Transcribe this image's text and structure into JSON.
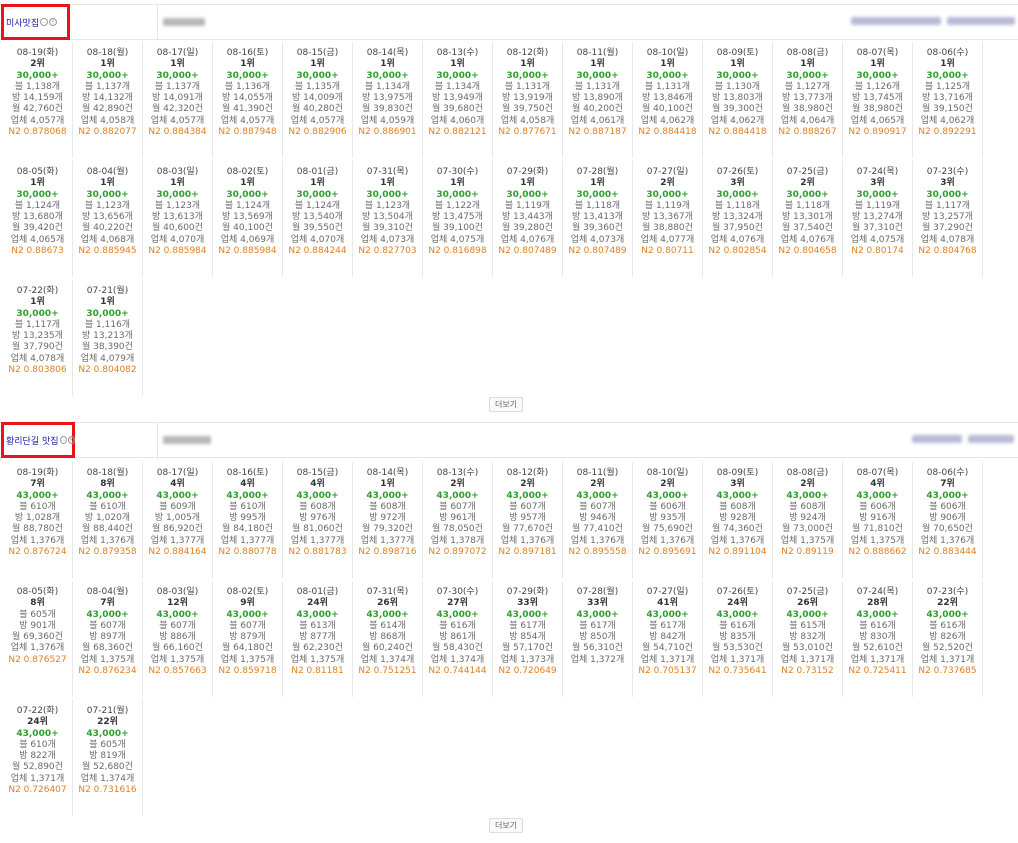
{
  "common": {
    "more_label": "더보기",
    "icon_glyph": "ⓟ"
  },
  "sections": [
    {
      "keyword": "미사맛집",
      "days": [
        {
          "date": "08-19(화)",
          "rank": "2위",
          "search": "30,000+",
          "posts": "블 1,138개",
          "shops": "방 14,159개",
          "monthly": "월 42,760건",
          "biz": "업체 4,057개",
          "n2": "N2 0.878068"
        },
        {
          "date": "08-18(월)",
          "rank": "1위",
          "search": "30,000+",
          "posts": "블 1,137개",
          "shops": "방 14,132개",
          "monthly": "월 42,890건",
          "biz": "업체 4,058개",
          "n2": "N2 0.882077"
        },
        {
          "date": "08-17(일)",
          "rank": "1위",
          "search": "30,000+",
          "posts": "블 1,137개",
          "shops": "방 14,091개",
          "monthly": "월 42,320건",
          "biz": "업체 4,057개",
          "n2": "N2 0.884384"
        },
        {
          "date": "08-16(토)",
          "rank": "1위",
          "search": "30,000+",
          "posts": "블 1,136개",
          "shops": "방 14,055개",
          "monthly": "월 41,390건",
          "biz": "업체 4,057개",
          "n2": "N2 0.887948"
        },
        {
          "date": "08-15(금)",
          "rank": "1위",
          "search": "30,000+",
          "posts": "블 1,135개",
          "shops": "방 14,009개",
          "monthly": "월 40,280건",
          "biz": "업체 4,057개",
          "n2": "N2 0.882906"
        },
        {
          "date": "08-14(목)",
          "rank": "1위",
          "search": "30,000+",
          "posts": "블 1,134개",
          "shops": "방 13,975개",
          "monthly": "월 39,830건",
          "biz": "업체 4,059개",
          "n2": "N2 0.886901"
        },
        {
          "date": "08-13(수)",
          "rank": "1위",
          "search": "30,000+",
          "posts": "블 1,134개",
          "shops": "방 13,949개",
          "monthly": "월 39,680건",
          "biz": "업체 4,060개",
          "n2": "N2 0.882121"
        },
        {
          "date": "08-12(화)",
          "rank": "1위",
          "search": "30,000+",
          "posts": "블 1,131개",
          "shops": "방 13,919개",
          "monthly": "월 39,750건",
          "biz": "업체 4,058개",
          "n2": "N2 0.877671"
        },
        {
          "date": "08-11(월)",
          "rank": "1위",
          "search": "30,000+",
          "posts": "블 1,131개",
          "shops": "방 13,890개",
          "monthly": "월 40,200건",
          "biz": "업체 4,061개",
          "n2": "N2 0.887187"
        },
        {
          "date": "08-10(일)",
          "rank": "1위",
          "search": "30,000+",
          "posts": "블 1,131개",
          "shops": "방 13,846개",
          "monthly": "월 40,100건",
          "biz": "업체 4,062개",
          "n2": "N2 0.884418"
        },
        {
          "date": "08-09(토)",
          "rank": "1위",
          "search": "30,000+",
          "posts": "블 1,130개",
          "shops": "방 13,803개",
          "monthly": "월 39,300건",
          "biz": "업체 4,062개",
          "n2": "N2 0.884418"
        },
        {
          "date": "08-08(금)",
          "rank": "1위",
          "search": "30,000+",
          "posts": "블 1,127개",
          "shops": "방 13,773개",
          "monthly": "월 38,980건",
          "biz": "업체 4,064개",
          "n2": "N2 0.888267"
        },
        {
          "date": "08-07(목)",
          "rank": "1위",
          "search": "30,000+",
          "posts": "블 1,126개",
          "shops": "방 13,745개",
          "monthly": "월 38,980건",
          "biz": "업체 4,065개",
          "n2": "N2 0.890917"
        },
        {
          "date": "08-06(수)",
          "rank": "1위",
          "search": "30,000+",
          "posts": "블 1,125개",
          "shops": "방 13,716개",
          "monthly": "월 39,150건",
          "biz": "업체 4,062개",
          "n2": "N2 0.892291"
        },
        {
          "date": "08-05(화)",
          "rank": "1위",
          "search": "30,000+",
          "posts": "블 1,124개",
          "shops": "방 13,680개",
          "monthly": "월 39,420건",
          "biz": "업체 4,065개",
          "n2": "N2 0.88673"
        },
        {
          "date": "08-04(월)",
          "rank": "1위",
          "search": "30,000+",
          "posts": "블 1,123개",
          "shops": "방 13,656개",
          "monthly": "월 40,220건",
          "biz": "업체 4,068개",
          "n2": "N2 0.885945"
        },
        {
          "date": "08-03(일)",
          "rank": "1위",
          "search": "30,000+",
          "posts": "블 1,123개",
          "shops": "방 13,613개",
          "monthly": "월 40,600건",
          "biz": "업체 4,070개",
          "n2": "N2 0.885984"
        },
        {
          "date": "08-02(토)",
          "rank": "1위",
          "search": "30,000+",
          "posts": "블 1,124개",
          "shops": "방 13,569개",
          "monthly": "월 40,100건",
          "biz": "업체 4,069개",
          "n2": "N2 0.885984"
        },
        {
          "date": "08-01(금)",
          "rank": "1위",
          "search": "30,000+",
          "posts": "블 1,124개",
          "shops": "방 13,540개",
          "monthly": "월 39,550건",
          "biz": "업체 4,070개",
          "n2": "N2 0.884244"
        },
        {
          "date": "07-31(목)",
          "rank": "1위",
          "search": "30,000+",
          "posts": "블 1,123개",
          "shops": "방 13,504개",
          "monthly": "월 39,310건",
          "biz": "업체 4,073개",
          "n2": "N2 0.827703"
        },
        {
          "date": "07-30(수)",
          "rank": "1위",
          "search": "30,000+",
          "posts": "블 1,122개",
          "shops": "방 13,475개",
          "monthly": "월 39,100건",
          "biz": "업체 4,075개",
          "n2": "N2 0.816898"
        },
        {
          "date": "07-29(화)",
          "rank": "1위",
          "search": "30,000+",
          "posts": "블 1,119개",
          "shops": "방 13,443개",
          "monthly": "월 39,280건",
          "biz": "업체 4,076개",
          "n2": "N2 0.807489"
        },
        {
          "date": "07-28(월)",
          "rank": "1위",
          "search": "30,000+",
          "posts": "블 1,118개",
          "shops": "방 13,413개",
          "monthly": "월 39,360건",
          "biz": "업체 4,073개",
          "n2": "N2 0.807489"
        },
        {
          "date": "07-27(일)",
          "rank": "2위",
          "search": "30,000+",
          "posts": "블 1,119개",
          "shops": "방 13,367개",
          "monthly": "월 38,880건",
          "biz": "업체 4,077개",
          "n2": "N2 0.80711"
        },
        {
          "date": "07-26(토)",
          "rank": "3위",
          "search": "30,000+",
          "posts": "블 1,118개",
          "shops": "방 13,324개",
          "monthly": "월 37,950건",
          "biz": "업체 4,076개",
          "n2": "N2 0.802854"
        },
        {
          "date": "07-25(금)",
          "rank": "2위",
          "search": "30,000+",
          "posts": "블 1,118개",
          "shops": "방 13,301개",
          "monthly": "월 37,540건",
          "biz": "업체 4,076개",
          "n2": "N2 0.804658"
        },
        {
          "date": "07-24(목)",
          "rank": "3위",
          "search": "30,000+",
          "posts": "블 1,119개",
          "shops": "방 13,274개",
          "monthly": "월 37,310건",
          "biz": "업체 4,075개",
          "n2": "N2 0.80174"
        },
        {
          "date": "07-23(수)",
          "rank": "3위",
          "search": "30,000+",
          "posts": "블 1,117개",
          "shops": "방 13,257개",
          "monthly": "월 37,290건",
          "biz": "업체 4,078개",
          "n2": "N2 0.804768"
        },
        {
          "date": "07-22(화)",
          "rank": "1위",
          "search": "30,000+",
          "posts": "블 1,117개",
          "shops": "방 13,235개",
          "monthly": "월 37,790건",
          "biz": "업체 4,078개",
          "n2": "N2 0.803806"
        },
        {
          "date": "07-21(월)",
          "rank": "1위",
          "search": "30,000+",
          "posts": "블 1,116개",
          "shops": "방 13,213개",
          "monthly": "월 38,390건",
          "biz": "업체 4,079개",
          "n2": "N2 0.804082"
        }
      ]
    },
    {
      "keyword": "황리단길 맛집",
      "days": [
        {
          "date": "08-19(화)",
          "rank": "7위",
          "search": "43,000+",
          "posts": "블 610개",
          "shops": "방 1,028개",
          "monthly": "월 88,780건",
          "biz": "업체 1,376개",
          "n2": "N2 0.876724"
        },
        {
          "date": "08-18(월)",
          "rank": "8위",
          "search": "43,000+",
          "posts": "블 610개",
          "shops": "방 1,020개",
          "monthly": "월 88,440건",
          "biz": "업체 1,376개",
          "n2": "N2 0.879358"
        },
        {
          "date": "08-17(일)",
          "rank": "4위",
          "search": "43,000+",
          "posts": "블 609개",
          "shops": "방 1,005개",
          "monthly": "월 86,920건",
          "biz": "업체 1,377개",
          "n2": "N2 0.884164"
        },
        {
          "date": "08-16(토)",
          "rank": "4위",
          "search": "43,000+",
          "posts": "블 610개",
          "shops": "방 995개",
          "monthly": "월 84,180건",
          "biz": "업체 1,377개",
          "n2": "N2 0.880778"
        },
        {
          "date": "08-15(금)",
          "rank": "4위",
          "search": "43,000+",
          "posts": "블 608개",
          "shops": "방 976개",
          "monthly": "월 81,060건",
          "biz": "업체 1,377개",
          "n2": "N2 0.881783"
        },
        {
          "date": "08-14(목)",
          "rank": "1위",
          "search": "43,000+",
          "posts": "블 608개",
          "shops": "방 972개",
          "monthly": "월 79,320건",
          "biz": "업체 1,377개",
          "n2": "N2 0.898716"
        },
        {
          "date": "08-13(수)",
          "rank": "2위",
          "search": "43,000+",
          "posts": "블 607개",
          "shops": "방 961개",
          "monthly": "월 78,050건",
          "biz": "업체 1,378개",
          "n2": "N2 0.897072"
        },
        {
          "date": "08-12(화)",
          "rank": "2위",
          "search": "43,000+",
          "posts": "블 607개",
          "shops": "방 957개",
          "monthly": "월 77,670건",
          "biz": "업체 1,376개",
          "n2": "N2 0.897181"
        },
        {
          "date": "08-11(월)",
          "rank": "2위",
          "search": "43,000+",
          "posts": "블 607개",
          "shops": "방 946개",
          "monthly": "월 77,410건",
          "biz": "업체 1,376개",
          "n2": "N2 0.895558"
        },
        {
          "date": "08-10(일)",
          "rank": "2위",
          "search": "43,000+",
          "posts": "블 606개",
          "shops": "방 935개",
          "monthly": "월 75,690건",
          "biz": "업체 1,376개",
          "n2": "N2 0.895691"
        },
        {
          "date": "08-09(토)",
          "rank": "3위",
          "search": "43,000+",
          "posts": "블 608개",
          "shops": "방 928개",
          "monthly": "월 74,360건",
          "biz": "업체 1,376개",
          "n2": "N2 0.891104"
        },
        {
          "date": "08-08(금)",
          "rank": "2위",
          "search": "43,000+",
          "posts": "블 608개",
          "shops": "방 924개",
          "monthly": "월 73,000건",
          "biz": "업체 1,375개",
          "n2": "N2 0.89119"
        },
        {
          "date": "08-07(목)",
          "rank": "4위",
          "search": "43,000+",
          "posts": "블 606개",
          "shops": "방 916개",
          "monthly": "월 71,810건",
          "biz": "업체 1,375개",
          "n2": "N2 0.888662"
        },
        {
          "date": "08-06(수)",
          "rank": "7위",
          "search": "43,000+",
          "posts": "블 606개",
          "shops": "방 906개",
          "monthly": "월 70,650건",
          "biz": "업체 1,376개",
          "n2": "N2 0.883444"
        },
        {
          "date": "08-05(화)",
          "rank": "8위",
          "search": "",
          "posts": "블 605개",
          "shops": "방 901개",
          "monthly": "월 69,360건",
          "biz": "업체 1,376개",
          "n2": "N2 0.876527"
        },
        {
          "date": "08-04(월)",
          "rank": "7위",
          "search": "43,000+",
          "posts": "블 607개",
          "shops": "방 897개",
          "monthly": "월 68,360건",
          "biz": "업체 1,375개",
          "n2": "N2 0.876234"
        },
        {
          "date": "08-03(일)",
          "rank": "12위",
          "search": "43,000+",
          "posts": "블 607개",
          "shops": "방 886개",
          "monthly": "월 66,160건",
          "biz": "업체 1,375개",
          "n2": "N2 0.857663"
        },
        {
          "date": "08-02(토)",
          "rank": "9위",
          "search": "43,000+",
          "posts": "블 607개",
          "shops": "방 879개",
          "monthly": "월 64,180건",
          "biz": "업체 1,375개",
          "n2": "N2 0.859718"
        },
        {
          "date": "08-01(금)",
          "rank": "24위",
          "search": "43,000+",
          "posts": "블 613개",
          "shops": "방 877개",
          "monthly": "월 62,230건",
          "biz": "업체 1,375개",
          "n2": "N2 0.81181"
        },
        {
          "date": "07-31(목)",
          "rank": "26위",
          "search": "43,000+",
          "posts": "블 614개",
          "shops": "방 868개",
          "monthly": "월 60,240건",
          "biz": "업체 1,374개",
          "n2": "N2 0.751251"
        },
        {
          "date": "07-30(수)",
          "rank": "27위",
          "search": "43,000+",
          "posts": "블 616개",
          "shops": "방 861개",
          "monthly": "월 58,430건",
          "biz": "업체 1,374개",
          "n2": "N2 0.744144"
        },
        {
          "date": "07-29(화)",
          "rank": "33위",
          "search": "43,000+",
          "posts": "블 617개",
          "shops": "방 854개",
          "monthly": "월 57,170건",
          "biz": "업체 1,373개",
          "n2": "N2 0.720649"
        },
        {
          "date": "07-28(월)",
          "rank": "33위",
          "search": "43,000+",
          "posts": "블 617개",
          "shops": "방 850개",
          "monthly": "월 56,310건",
          "biz": "업체 1,372개",
          "n2": ""
        },
        {
          "date": "07-27(일)",
          "rank": "41위",
          "search": "43,000+",
          "posts": "블 617개",
          "shops": "방 842개",
          "monthly": "월 54,710건",
          "biz": "업체 1,371개",
          "n2": "N2 0.705137"
        },
        {
          "date": "07-26(토)",
          "rank": "24위",
          "search": "43,000+",
          "posts": "블 616개",
          "shops": "방 835개",
          "monthly": "월 53,530건",
          "biz": "업체 1,371개",
          "n2": "N2 0.735641"
        },
        {
          "date": "07-25(금)",
          "rank": "26위",
          "search": "43,000+",
          "posts": "블 615개",
          "shops": "방 832개",
          "monthly": "월 53,010건",
          "biz": "업체 1,371개",
          "n2": "N2 0.73152"
        },
        {
          "date": "07-24(목)",
          "rank": "28위",
          "search": "43,000+",
          "posts": "블 616개",
          "shops": "방 830개",
          "monthly": "월 52,610건",
          "biz": "업체 1,371개",
          "n2": "N2 0.725411"
        },
        {
          "date": "07-23(수)",
          "rank": "22위",
          "search": "43,000+",
          "posts": "블 616개",
          "shops": "방 826개",
          "monthly": "월 52,520건",
          "biz": "업체 1,371개",
          "n2": "N2 0.737685"
        },
        {
          "date": "07-22(화)",
          "rank": "24위",
          "search": "43,000+",
          "posts": "블 610개",
          "shops": "방 822개",
          "monthly": "월 52,890건",
          "biz": "업체 1,371개",
          "n2": "N2 0.726407"
        },
        {
          "date": "07-21(월)",
          "rank": "22위",
          "search": "43,000+",
          "posts": "블 605개",
          "shops": "방 819개",
          "monthly": "월 52,680건",
          "biz": "업체 1,374개",
          "n2": "N2 0.731616"
        }
      ]
    }
  ]
}
